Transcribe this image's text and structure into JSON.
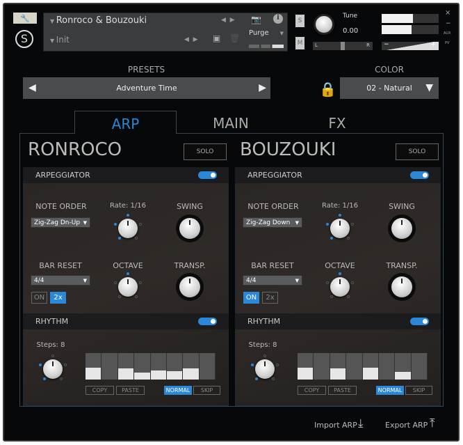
{
  "header": {
    "instrument": "Ronroco & Bouzouki",
    "preset_slot": "Init",
    "purge_label": "Purge",
    "s_label": "S",
    "m_label": "M",
    "tune_label": "Tune",
    "tune_value": "0.00",
    "pan_left": "L",
    "pan_right": "R",
    "vol_minus": "−",
    "vol_plus": "+",
    "aux_label": "AUX",
    "pv_label": "PV",
    "close": "×",
    "minimize": "−"
  },
  "presets": {
    "label": "PRESETS",
    "value": "Adventure Time"
  },
  "color": {
    "label": "COLOR",
    "value": "02 - Natural"
  },
  "tabs": [
    {
      "label": "ARP",
      "active": true
    },
    {
      "label": "MAIN"
    },
    {
      "label": "FX"
    }
  ],
  "accent": "#2b88d8",
  "panels": [
    {
      "name": "RONROCO",
      "solo": "SOLO",
      "arp_label": "ARPEGGIATOR",
      "arp_on": true,
      "note_order_label": "NOTE ORDER",
      "note_order": "Zig-Zag Dn-Up",
      "rate_label": "Rate: 1/16",
      "swing_label": "SWING",
      "bar_reset_label": "BAR RESET",
      "bar_reset": "4/4",
      "on_label": "ON",
      "x2_label": "2x",
      "on_active": false,
      "x2_active": true,
      "octave_label": "OCTAVE",
      "transp_label": "TRANSP.",
      "rhythm_label": "RHYTHM",
      "rhythm_on": true,
      "steps_label": "Steps: 8",
      "steps": [
        0.45,
        0,
        0.42,
        0.27,
        0.35,
        0.32,
        0.42,
        0
      ],
      "copy": "COPY",
      "paste": "PASTE",
      "normal": "NORMAL",
      "skip": "SKIP"
    },
    {
      "name": "BOUZOUKI",
      "solo": "SOLO",
      "arp_label": "ARPEGGIATOR",
      "arp_on": true,
      "note_order_label": "NOTE ORDER",
      "note_order": "Zig-Zag Down",
      "rate_label": "Rate: 1/16",
      "swing_label": "SWING",
      "bar_reset_label": "BAR RESET",
      "bar_reset": "4/4",
      "on_label": "ON",
      "x2_label": "2x",
      "on_active": true,
      "x2_active": false,
      "octave_label": "OCTAVE",
      "transp_label": "TRANSP.",
      "rhythm_label": "RHYTHM",
      "rhythm_on": true,
      "steps_label": "Steps: 8",
      "steps": [
        0.45,
        0,
        0.42,
        0,
        0.45,
        0,
        0.3,
        0
      ],
      "copy": "COPY",
      "paste": "PASTE",
      "normal": "NORMAL",
      "skip": "SKIP"
    }
  ],
  "footer": {
    "import": "Import ARP",
    "export": "Export ARP"
  }
}
